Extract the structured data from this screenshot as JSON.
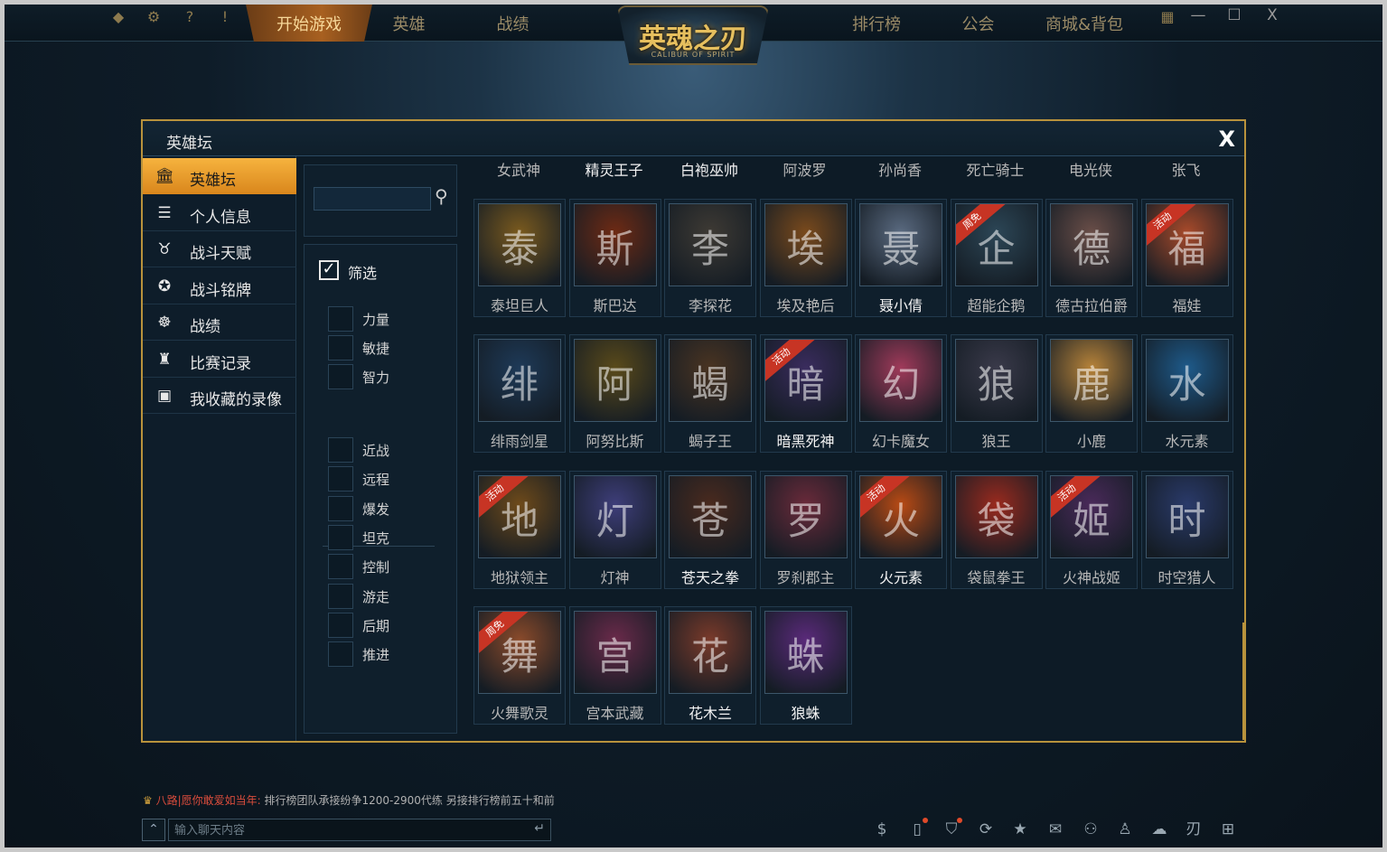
{
  "nav": {
    "tabs": [
      "开始游戏",
      "英雄",
      "战绩",
      "排行榜",
      "公会",
      "商城&背包"
    ],
    "active_tab": "开始游戏"
  },
  "logo": {
    "title": "英魂之刃",
    "subtitle": "CALIBUR OF SPIRIT"
  },
  "top_icons": [
    "diamond-icon",
    "gear-icon",
    "help-icon",
    "alert-icon"
  ],
  "window_controls": {
    "minimize": "—",
    "maximize": "☐",
    "close": "X"
  },
  "dialog": {
    "title": "英雄坛",
    "close_label": "X"
  },
  "sidebar": {
    "items": [
      {
        "label": "英雄坛",
        "icon": "temple-icon",
        "active": true
      },
      {
        "label": "个人信息",
        "icon": "profile-icon"
      },
      {
        "label": "战斗天赋",
        "icon": "talent-icon"
      },
      {
        "label": "战斗铭牌",
        "icon": "badge-icon"
      },
      {
        "label": "战绩",
        "icon": "record-icon"
      },
      {
        "label": "比赛记录",
        "icon": "trophy-icon"
      },
      {
        "label": "我收藏的录像",
        "icon": "video-icon"
      }
    ]
  },
  "search": {
    "value": "",
    "placeholder": ""
  },
  "filter": {
    "master_label": "筛选",
    "master_checked": true,
    "attributes": [
      "力量",
      "敏捷",
      "智力"
    ],
    "roles": [
      "近战",
      "远程",
      "爆发",
      "坦克",
      "控制",
      "游走",
      "后期",
      "推进"
    ]
  },
  "heroes_top_row": [
    {
      "name": "女武神",
      "bright": false
    },
    {
      "name": "精灵王子",
      "bright": true
    },
    {
      "name": "白袍巫帅",
      "bright": true
    },
    {
      "name": "阿波罗",
      "bright": false
    },
    {
      "name": "孙尚香",
      "bright": false
    },
    {
      "name": "死亡骑士",
      "bright": false
    },
    {
      "name": "电光侠",
      "bright": false
    },
    {
      "name": "张飞",
      "bright": false
    }
  ],
  "heroes": [
    {
      "name": "泰坦巨人",
      "glyph": "泰",
      "color": "#7a5a1e",
      "bright": false,
      "badge": ""
    },
    {
      "name": "斯巴达",
      "glyph": "斯",
      "color": "#6e2a14",
      "bright": false,
      "badge": ""
    },
    {
      "name": "李探花",
      "glyph": "李",
      "color": "#3e3a34",
      "bright": false,
      "badge": ""
    },
    {
      "name": "埃及艳后",
      "glyph": "埃",
      "color": "#7a4a1c",
      "bright": false,
      "badge": ""
    },
    {
      "name": "聂小倩",
      "glyph": "聂",
      "color": "#5a6a80",
      "bright": true,
      "badge": ""
    },
    {
      "name": "超能企鹅",
      "glyph": "企",
      "color": "#2c4656",
      "bright": false,
      "badge": "周免"
    },
    {
      "name": "德古拉伯爵",
      "glyph": "德",
      "color": "#6a4e48",
      "bright": false,
      "badge": ""
    },
    {
      "name": "福娃",
      "glyph": "福",
      "color": "#a84a2a",
      "bright": false,
      "badge": "活动"
    },
    {
      "name": "绯雨剑星",
      "glyph": "绯",
      "color": "#1e3a58",
      "bright": false,
      "badge": ""
    },
    {
      "name": "阿努比斯",
      "glyph": "阿",
      "color": "#5a4a1a",
      "bright": false,
      "badge": ""
    },
    {
      "name": "蝎子王",
      "glyph": "蝎",
      "color": "#4a3422",
      "bright": false,
      "badge": ""
    },
    {
      "name": "暗黑死神",
      "glyph": "暗",
      "color": "#3a2c5e",
      "bright": true,
      "badge": "活动"
    },
    {
      "name": "幻卡魔女",
      "glyph": "幻",
      "color": "#a03a5a",
      "bright": false,
      "badge": ""
    },
    {
      "name": "狼王",
      "glyph": "狼",
      "color": "#3a3a4a",
      "bright": false,
      "badge": ""
    },
    {
      "name": "小鹿",
      "glyph": "鹿",
      "color": "#b8843a",
      "bright": false,
      "badge": ""
    },
    {
      "name": "水元素",
      "glyph": "水",
      "color": "#1e5a8a",
      "bright": false,
      "badge": ""
    },
    {
      "name": "地狱领主",
      "glyph": "地",
      "color": "#6e4a1a",
      "bright": false,
      "badge": "活动"
    },
    {
      "name": "灯神",
      "glyph": "灯",
      "color": "#3e3e7a",
      "bright": false,
      "badge": ""
    },
    {
      "name": "苍天之拳",
      "glyph": "苍",
      "color": "#4a2a1e",
      "bright": true,
      "badge": ""
    },
    {
      "name": "罗刹郡主",
      "glyph": "罗",
      "color": "#6a2a3a",
      "bright": false,
      "badge": ""
    },
    {
      "name": "火元素",
      "glyph": "火",
      "color": "#b84a14",
      "bright": true,
      "badge": "活动"
    },
    {
      "name": "袋鼠拳王",
      "glyph": "袋",
      "color": "#9a2a1e",
      "bright": false,
      "badge": ""
    },
    {
      "name": "火神战姬",
      "glyph": "姬",
      "color": "#4a2a5a",
      "bright": false,
      "badge": "活动"
    },
    {
      "name": "时空猎人",
      "glyph": "时",
      "color": "#2a3a6a",
      "bright": false,
      "badge": ""
    },
    {
      "name": "火舞歌灵",
      "glyph": "舞",
      "color": "#8a4a2a",
      "bright": false,
      "badge": "周免"
    },
    {
      "name": "宫本武藏",
      "glyph": "宫",
      "color": "#6a2a4a",
      "bright": false,
      "badge": ""
    },
    {
      "name": "花木兰",
      "glyph": "花",
      "color": "#7a3a2a",
      "bright": true,
      "badge": ""
    },
    {
      "name": "狼蛛",
      "glyph": "蛛",
      "color": "#5a2a7a",
      "bright": true,
      "badge": ""
    }
  ],
  "ticker": {
    "prefix": "八路|愿你敢爱如当年:",
    "message": "排行榜团队承接纷争1200-2900代练 另接排行榜前五十和前"
  },
  "chat": {
    "placeholder": "输入聊天内容",
    "value": ""
  },
  "bottom_icons": [
    "moneybag-icon",
    "phone-icon",
    "shield-icon",
    "refresh-icon",
    "star-icon",
    "mail-icon",
    "friends-icon",
    "user-icon",
    "wechat-icon",
    "logo-icon",
    "gift-icon"
  ]
}
